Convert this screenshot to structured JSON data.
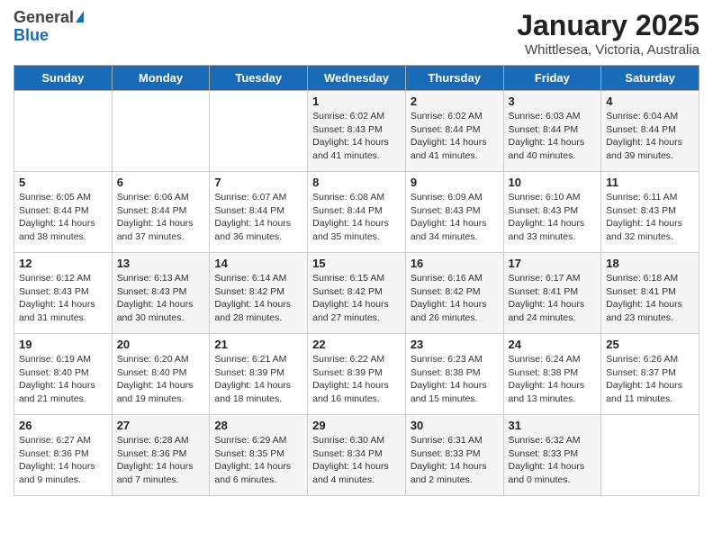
{
  "header": {
    "logo_general": "General",
    "logo_blue": "Blue",
    "title": "January 2025",
    "subtitle": "Whittlesea, Victoria, Australia"
  },
  "weekdays": [
    "Sunday",
    "Monday",
    "Tuesday",
    "Wednesday",
    "Thursday",
    "Friday",
    "Saturday"
  ],
  "weeks": [
    [
      {
        "day": "",
        "info": ""
      },
      {
        "day": "",
        "info": ""
      },
      {
        "day": "",
        "info": ""
      },
      {
        "day": "1",
        "info": "Sunrise: 6:02 AM\nSunset: 8:43 PM\nDaylight: 14 hours\nand 41 minutes."
      },
      {
        "day": "2",
        "info": "Sunrise: 6:02 AM\nSunset: 8:44 PM\nDaylight: 14 hours\nand 41 minutes."
      },
      {
        "day": "3",
        "info": "Sunrise: 6:03 AM\nSunset: 8:44 PM\nDaylight: 14 hours\nand 40 minutes."
      },
      {
        "day": "4",
        "info": "Sunrise: 6:04 AM\nSunset: 8:44 PM\nDaylight: 14 hours\nand 39 minutes."
      }
    ],
    [
      {
        "day": "5",
        "info": "Sunrise: 6:05 AM\nSunset: 8:44 PM\nDaylight: 14 hours\nand 38 minutes."
      },
      {
        "day": "6",
        "info": "Sunrise: 6:06 AM\nSunset: 8:44 PM\nDaylight: 14 hours\nand 37 minutes."
      },
      {
        "day": "7",
        "info": "Sunrise: 6:07 AM\nSunset: 8:44 PM\nDaylight: 14 hours\nand 36 minutes."
      },
      {
        "day": "8",
        "info": "Sunrise: 6:08 AM\nSunset: 8:44 PM\nDaylight: 14 hours\nand 35 minutes."
      },
      {
        "day": "9",
        "info": "Sunrise: 6:09 AM\nSunset: 8:43 PM\nDaylight: 14 hours\nand 34 minutes."
      },
      {
        "day": "10",
        "info": "Sunrise: 6:10 AM\nSunset: 8:43 PM\nDaylight: 14 hours\nand 33 minutes."
      },
      {
        "day": "11",
        "info": "Sunrise: 6:11 AM\nSunset: 8:43 PM\nDaylight: 14 hours\nand 32 minutes."
      }
    ],
    [
      {
        "day": "12",
        "info": "Sunrise: 6:12 AM\nSunset: 8:43 PM\nDaylight: 14 hours\nand 31 minutes."
      },
      {
        "day": "13",
        "info": "Sunrise: 6:13 AM\nSunset: 8:43 PM\nDaylight: 14 hours\nand 30 minutes."
      },
      {
        "day": "14",
        "info": "Sunrise: 6:14 AM\nSunset: 8:42 PM\nDaylight: 14 hours\nand 28 minutes."
      },
      {
        "day": "15",
        "info": "Sunrise: 6:15 AM\nSunset: 8:42 PM\nDaylight: 14 hours\nand 27 minutes."
      },
      {
        "day": "16",
        "info": "Sunrise: 6:16 AM\nSunset: 8:42 PM\nDaylight: 14 hours\nand 26 minutes."
      },
      {
        "day": "17",
        "info": "Sunrise: 6:17 AM\nSunset: 8:41 PM\nDaylight: 14 hours\nand 24 minutes."
      },
      {
        "day": "18",
        "info": "Sunrise: 6:18 AM\nSunset: 8:41 PM\nDaylight: 14 hours\nand 23 minutes."
      }
    ],
    [
      {
        "day": "19",
        "info": "Sunrise: 6:19 AM\nSunset: 8:40 PM\nDaylight: 14 hours\nand 21 minutes."
      },
      {
        "day": "20",
        "info": "Sunrise: 6:20 AM\nSunset: 8:40 PM\nDaylight: 14 hours\nand 19 minutes."
      },
      {
        "day": "21",
        "info": "Sunrise: 6:21 AM\nSunset: 8:39 PM\nDaylight: 14 hours\nand 18 minutes."
      },
      {
        "day": "22",
        "info": "Sunrise: 6:22 AM\nSunset: 8:39 PM\nDaylight: 14 hours\nand 16 minutes."
      },
      {
        "day": "23",
        "info": "Sunrise: 6:23 AM\nSunset: 8:38 PM\nDaylight: 14 hours\nand 15 minutes."
      },
      {
        "day": "24",
        "info": "Sunrise: 6:24 AM\nSunset: 8:38 PM\nDaylight: 14 hours\nand 13 minutes."
      },
      {
        "day": "25",
        "info": "Sunrise: 6:26 AM\nSunset: 8:37 PM\nDaylight: 14 hours\nand 11 minutes."
      }
    ],
    [
      {
        "day": "26",
        "info": "Sunrise: 6:27 AM\nSunset: 8:36 PM\nDaylight: 14 hours\nand 9 minutes."
      },
      {
        "day": "27",
        "info": "Sunrise: 6:28 AM\nSunset: 8:36 PM\nDaylight: 14 hours\nand 7 minutes."
      },
      {
        "day": "28",
        "info": "Sunrise: 6:29 AM\nSunset: 8:35 PM\nDaylight: 14 hours\nand 6 minutes."
      },
      {
        "day": "29",
        "info": "Sunrise: 6:30 AM\nSunset: 8:34 PM\nDaylight: 14 hours\nand 4 minutes."
      },
      {
        "day": "30",
        "info": "Sunrise: 6:31 AM\nSunset: 8:33 PM\nDaylight: 14 hours\nand 2 minutes."
      },
      {
        "day": "31",
        "info": "Sunrise: 6:32 AM\nSunset: 8:33 PM\nDaylight: 14 hours\nand 0 minutes."
      },
      {
        "day": "",
        "info": ""
      }
    ]
  ]
}
